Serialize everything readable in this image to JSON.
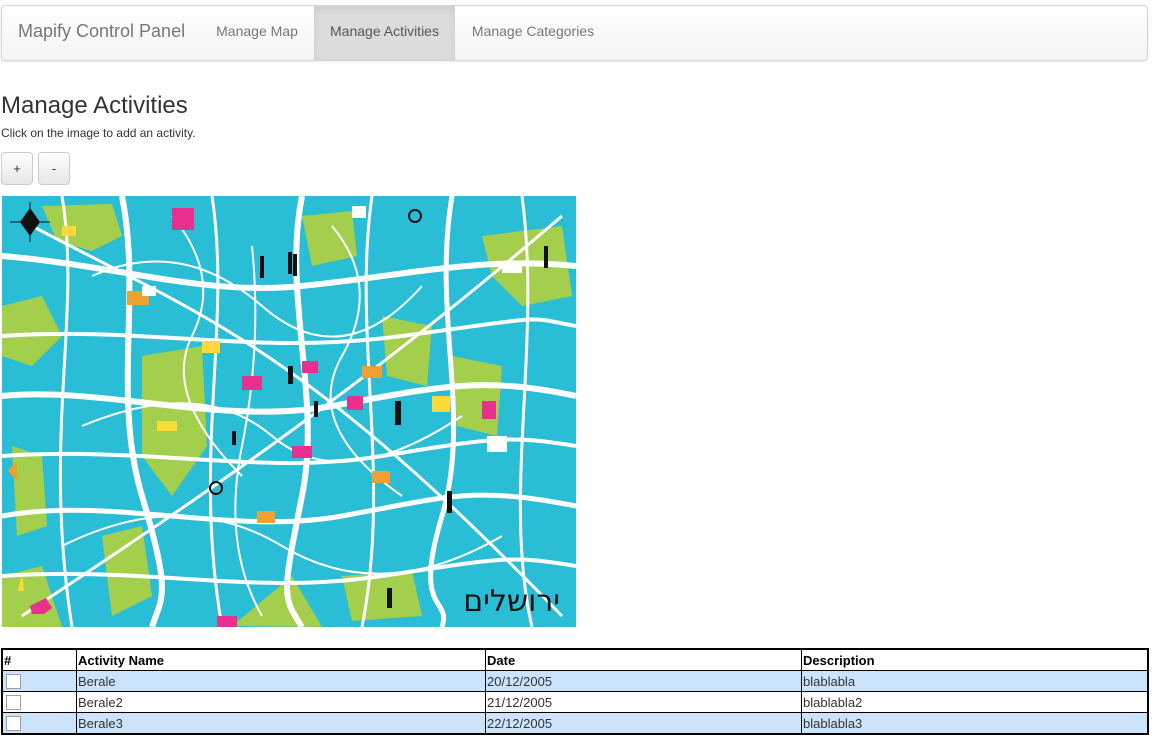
{
  "navbar": {
    "brand": "Mapify Control Panel",
    "items": [
      {
        "label": "Manage Map"
      },
      {
        "label": "Manage Activities",
        "active": true
      },
      {
        "label": "Manage Categories"
      }
    ]
  },
  "page": {
    "title": "Manage Activities",
    "hint": "Click on the image to add an activity."
  },
  "zoom": {
    "plus_label": "+",
    "minus_label": "-"
  },
  "map": {
    "label": "ירושלים",
    "colors": {
      "water": "#29bdd6",
      "park": "#a3cf4c",
      "road": "#ffffff"
    }
  },
  "table": {
    "headers": [
      "#",
      "Activity Name",
      "Date",
      "Description"
    ],
    "rows": [
      {
        "name": "Berale",
        "date": "20/12/2005",
        "description": "blablabla"
      },
      {
        "name": "Berale2",
        "date": "21/12/2005",
        "description": "blablabla2"
      },
      {
        "name": "Berale3",
        "date": "22/12/2005",
        "description": "blablabla3"
      }
    ]
  }
}
